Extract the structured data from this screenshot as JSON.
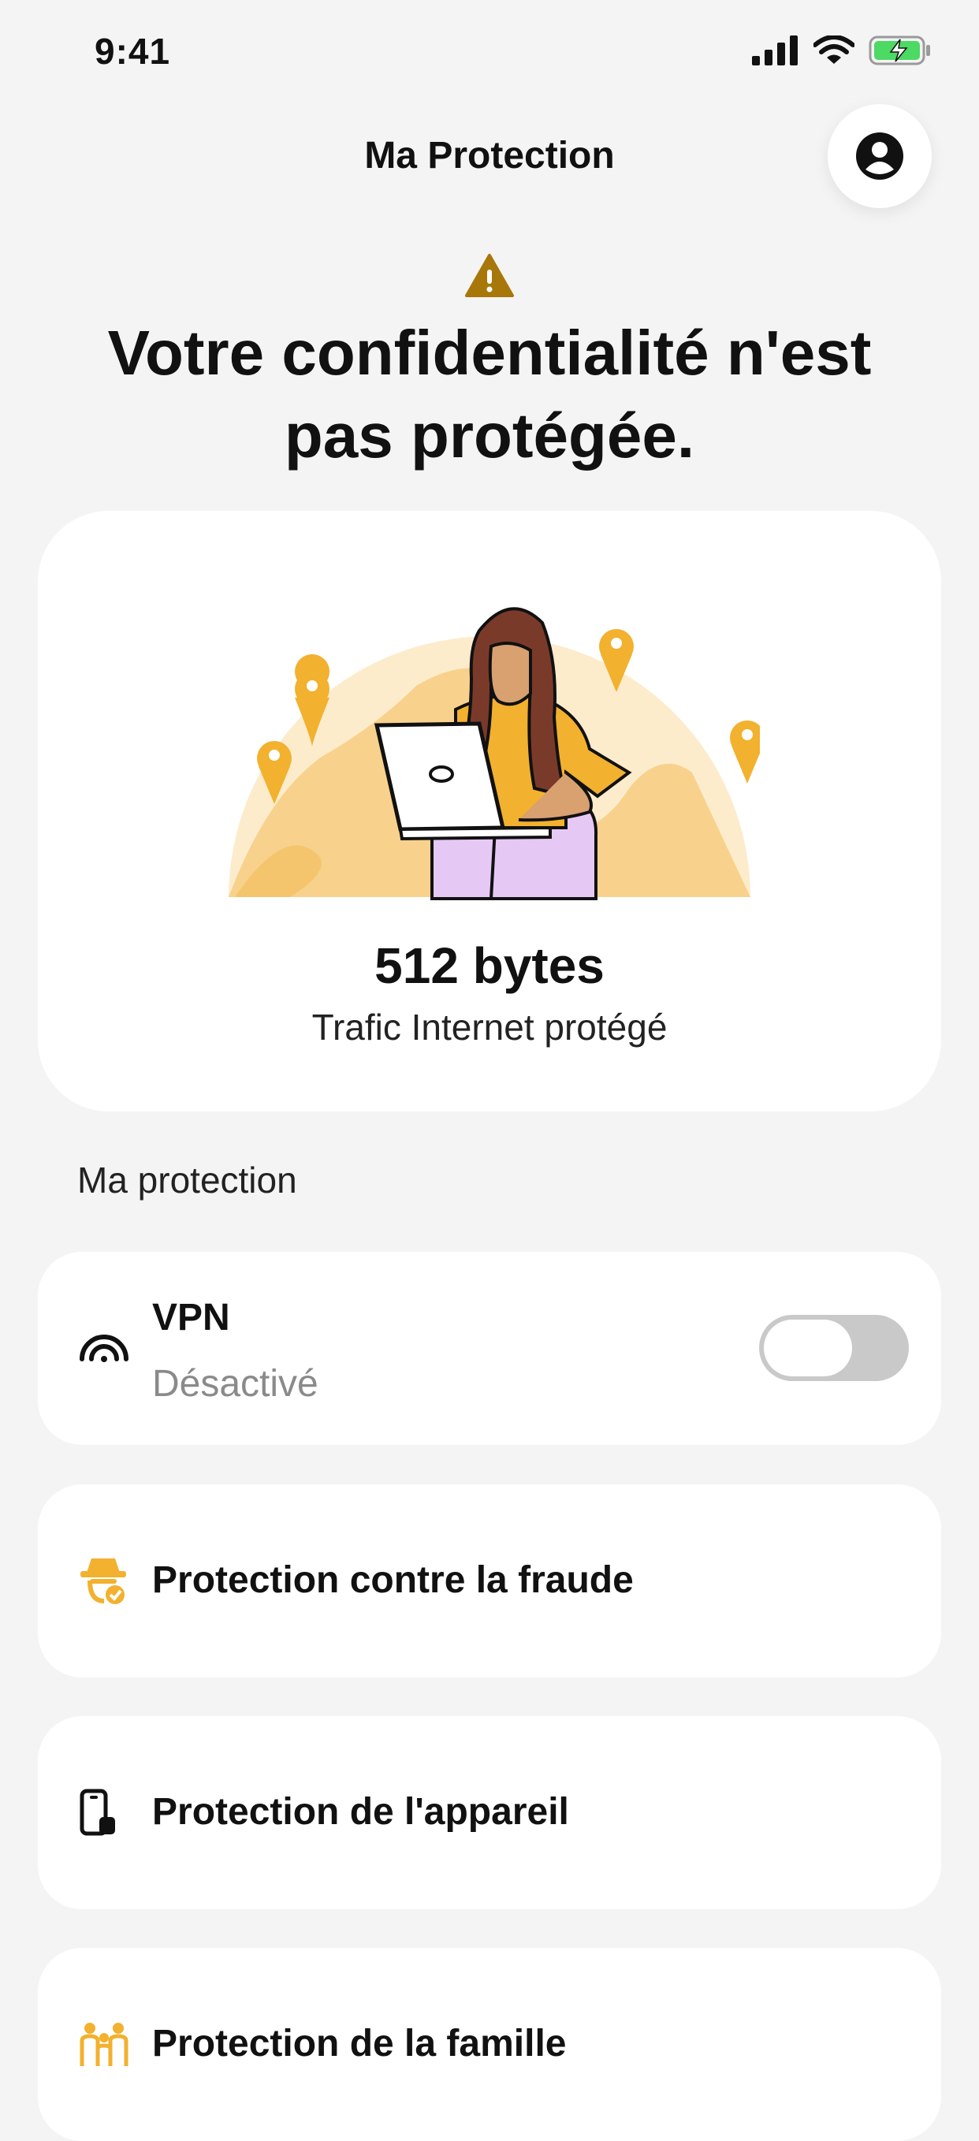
{
  "status": {
    "time": "9:41"
  },
  "header": {
    "title": "Ma Protection"
  },
  "alert": {
    "headline_line1": "Votre confidentialité n'est",
    "headline_line2": "pas protégée."
  },
  "hero": {
    "value": "512 bytes",
    "caption": "Trafic Internet protégé"
  },
  "section": {
    "label": "Ma protection"
  },
  "items": [
    {
      "title": "VPN",
      "subtitle": "Désactivé",
      "toggle_on": false,
      "icon": "vpn-signal-icon"
    },
    {
      "title": "Protection contre la fraude",
      "icon": "fraud-spy-icon"
    },
    {
      "title": "Protection de l'appareil",
      "icon": "device-lock-icon"
    },
    {
      "title": "Protection de la famille",
      "icon": "family-icon"
    }
  ],
  "colors": {
    "accent": "#f2b12e",
    "warning": "#a8770a",
    "background": "#f4f4f4",
    "toggle_off": "#c9c9c9"
  }
}
